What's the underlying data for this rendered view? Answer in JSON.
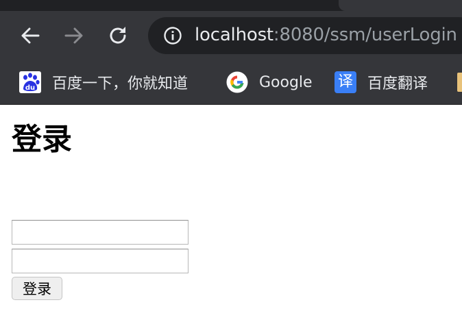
{
  "browser": {
    "url_host": "localhost",
    "url_rest": ":8080/ssm/userLogin",
    "bookmarks": [
      {
        "label": "百度一下，你就知道",
        "icon": "baidu-paw-icon"
      },
      {
        "label": "Google",
        "icon": "google-g-icon"
      },
      {
        "label": "百度翻译",
        "icon": "baidu-translate-icon",
        "icon_text": "译"
      }
    ],
    "colors": {
      "chrome_bg": "#35363a",
      "omnibox_bg": "#202124",
      "url_host": "#e8eaed",
      "url_rest": "#9aa0a6"
    }
  },
  "page": {
    "title": "登录",
    "username_value": "",
    "password_value": "",
    "login_button": "登录"
  }
}
